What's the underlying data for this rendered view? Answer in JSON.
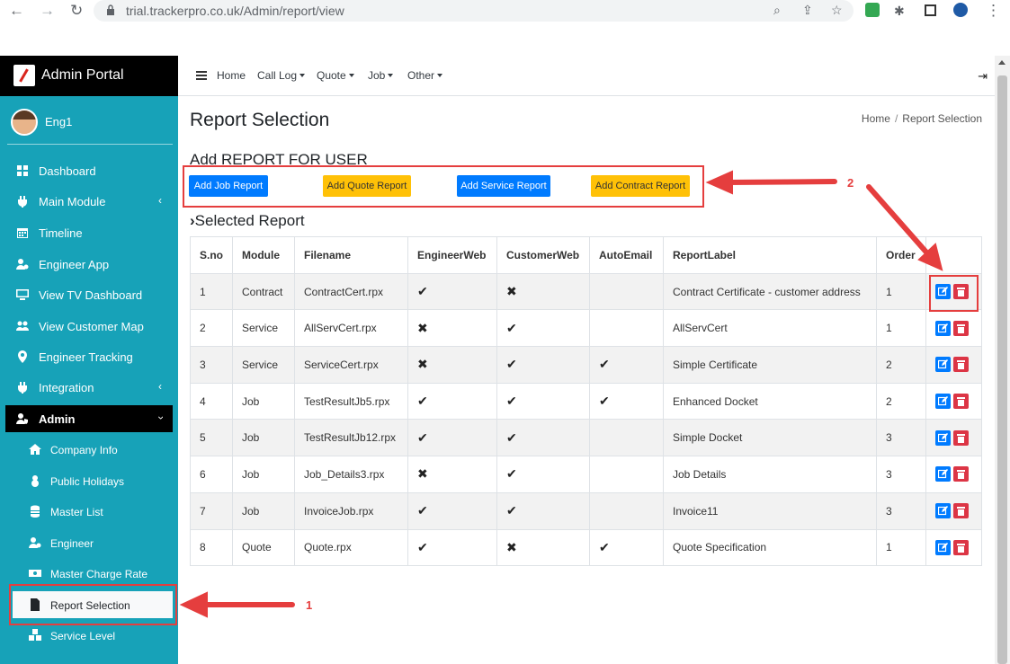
{
  "browser": {
    "url": "trial.trackerpro.co.uk/Admin/report/view",
    "icons": [
      "back-icon",
      "forward-icon",
      "reload-icon",
      "lock-icon",
      "zoom-icon",
      "share-icon",
      "star-icon",
      "extensions-icon",
      "menu-icon"
    ]
  },
  "brand": {
    "title": "Admin Portal"
  },
  "user": {
    "name": "Eng1"
  },
  "sidebar": {
    "items": [
      {
        "label": "Dashboard",
        "icon": "dashboard-icon"
      },
      {
        "label": "Main Module",
        "icon": "plug-icon"
      },
      {
        "label": "Timeline",
        "icon": "calendar-icon"
      },
      {
        "label": "Engineer App",
        "icon": "user-gear-icon"
      },
      {
        "label": "View TV Dashboard",
        "icon": "monitor-icon"
      },
      {
        "label": "View Customer Map",
        "icon": "users-icon"
      },
      {
        "label": "Engineer Tracking",
        "icon": "map-marker-icon"
      },
      {
        "label": "Integration",
        "icon": "plug-icon"
      },
      {
        "label": "Admin",
        "icon": "user-shield-icon"
      }
    ],
    "admin_sub": [
      {
        "label": "Company Info",
        "icon": "home-icon"
      },
      {
        "label": "Public Holidays",
        "icon": "snowman-icon"
      },
      {
        "label": "Master List",
        "icon": "database-icon"
      },
      {
        "label": "Engineer",
        "icon": "user-cog-icon"
      },
      {
        "label": "Master Charge Rate",
        "icon": "money-icon"
      },
      {
        "label": "Report Selection",
        "icon": "file-icon"
      },
      {
        "label": "Service Level",
        "icon": "boxes-icon"
      }
    ]
  },
  "topnav": {
    "home": "Home",
    "call_log": "Call Log",
    "quote": "Quote",
    "job": "Job",
    "other": "Other"
  },
  "page": {
    "title": "Report Selection",
    "breadcrumb_home": "Home",
    "breadcrumb_sep": "/",
    "breadcrumb_current": "Report Selection",
    "add_heading": "Add REPORT FOR USER",
    "selected_heading": "Selected Report"
  },
  "buttons": {
    "add_job": "Add Job Report",
    "add_quote": "Add Quote Report",
    "add_service": "Add Service Report",
    "add_contract": "Add Contract Report"
  },
  "table": {
    "headers": [
      "S.no",
      "Module",
      "Filename",
      "EngineerWeb",
      "CustomerWeb",
      "AutoEmail",
      "ReportLabel",
      "Order",
      ""
    ],
    "rows": [
      {
        "sno": "1",
        "module": "Contract",
        "filename": "ContractCert.rpx",
        "engineer_web": "✔",
        "customer_web": "✖",
        "auto_email": "",
        "label": "Contract Certificate - customer address",
        "order": "1"
      },
      {
        "sno": "2",
        "module": "Service",
        "filename": "AllServCert.rpx",
        "engineer_web": "✖",
        "customer_web": "✔",
        "auto_email": "",
        "label": "AllServCert",
        "order": "1"
      },
      {
        "sno": "3",
        "module": "Service",
        "filename": "ServiceCert.rpx",
        "engineer_web": "✖",
        "customer_web": "✔",
        "auto_email": "✔",
        "label": "Simple Certificate",
        "order": "2"
      },
      {
        "sno": "4",
        "module": "Job",
        "filename": "TestResultJb5.rpx",
        "engineer_web": "✔",
        "customer_web": "✔",
        "auto_email": "✔",
        "label": "Enhanced Docket",
        "order": "2"
      },
      {
        "sno": "5",
        "module": "Job",
        "filename": "TestResultJb12.rpx",
        "engineer_web": "✔",
        "customer_web": "✔",
        "auto_email": "",
        "label": "Simple Docket",
        "order": "3"
      },
      {
        "sno": "6",
        "module": "Job",
        "filename": "Job_Details3.rpx",
        "engineer_web": "✖",
        "customer_web": "✔",
        "auto_email": "",
        "label": "Job Details",
        "order": "3"
      },
      {
        "sno": "7",
        "module": "Job",
        "filename": "InvoiceJob.rpx",
        "engineer_web": "✔",
        "customer_web": "✔",
        "auto_email": "",
        "label": "Invoice11",
        "order": "3"
      },
      {
        "sno": "8",
        "module": "Quote",
        "filename": "Quote.rpx",
        "engineer_web": "✔",
        "customer_web": "✖",
        "auto_email": "✔",
        "label": "Quote Specification",
        "order": "1"
      }
    ]
  },
  "annotations": {
    "one": "1",
    "two": "2"
  },
  "colors": {
    "sidebar": "#17a2b8",
    "primary": "#007bff",
    "warning": "#ffc107",
    "danger": "#dc3545",
    "annotation": "#e53e3e"
  }
}
